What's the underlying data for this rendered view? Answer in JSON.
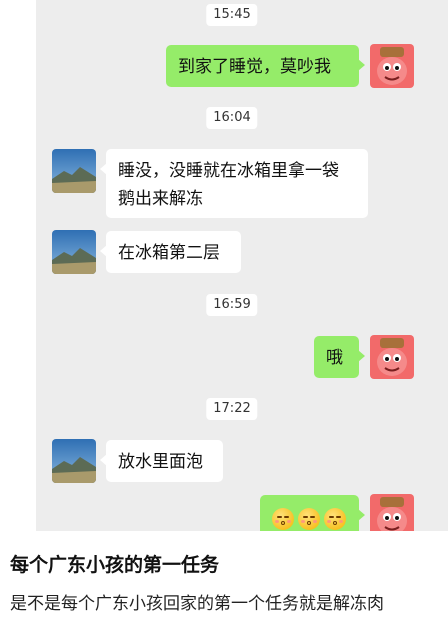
{
  "chat": {
    "timestamps": [
      "15:45",
      "16:04",
      "16:59",
      "17:22"
    ],
    "messages": [
      {
        "side": "right",
        "text": "到家了睡觉，莫吵我"
      },
      {
        "side": "left",
        "text_line1": "睡没，没睡就在冰箱里拿一袋",
        "text_line2": "鹅出来解冻"
      },
      {
        "side": "left",
        "text": "在冰箱第二层"
      },
      {
        "side": "right",
        "text": "哦"
      },
      {
        "side": "left",
        "text": "放水里面泡"
      },
      {
        "side": "right",
        "emoji": [
          "kissing-face",
          "kissing-face",
          "kissing-face"
        ]
      }
    ],
    "colors": {
      "background": "#ededed",
      "my_bubble": "#95ec69",
      "their_bubble": "#ffffff"
    },
    "avatars": {
      "mine": "patrick-star-avatar",
      "theirs": "mountain-landscape-avatar"
    }
  },
  "post": {
    "title": "每个广东小孩的第一任务",
    "subtitle": "是不是每个广东小孩回家的第一个任务就是解冻肉"
  }
}
